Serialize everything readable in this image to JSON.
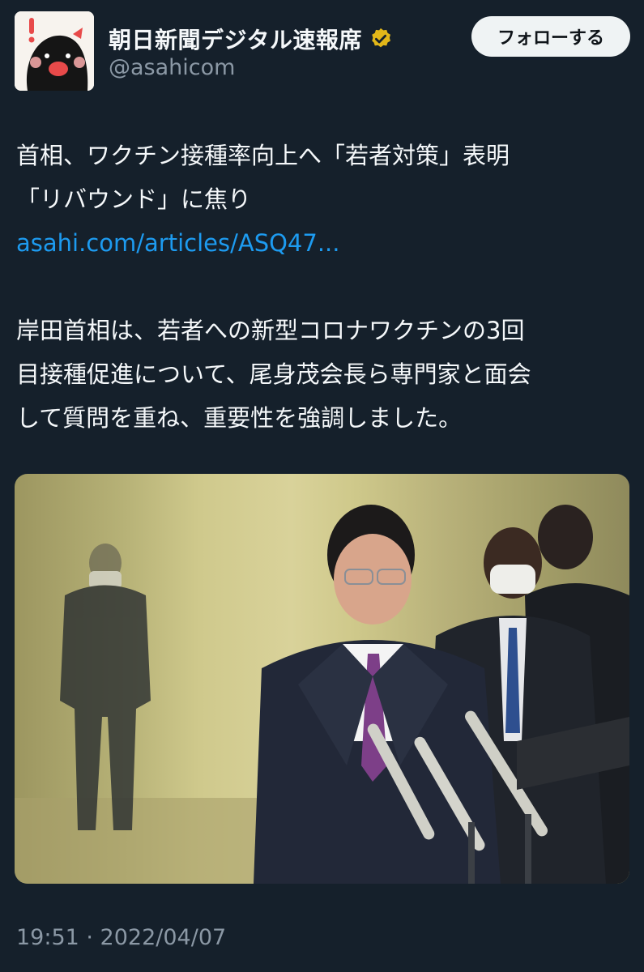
{
  "author": {
    "display_name": "朝日新聞デジタル速報席",
    "handle": "@asahicom",
    "verified_icon": "verified-badge-gold",
    "avatar_icon": "black-bird-mascot-avatar"
  },
  "follow_button": {
    "label": "フォローする"
  },
  "tweet": {
    "headline_line1": "首相、ワクチン接種率向上へ「若者対策」表明",
    "headline_line2": "「リバウンド」に焦り",
    "link_text": "asahi.com/articles/ASQ47...",
    "body_line1": "岸田首相は、若者への新型コロナワクチンの3回",
    "body_line2": "目接種促進について、尾身茂会長ら専門家と面会",
    "body_line3": "して質問を重ね、重要性を強調しました。"
  },
  "media": {
    "kind": "photo",
    "subject": "press-conference-photo"
  },
  "meta": {
    "timestamp": "19:51 · 2022/04/07"
  },
  "colors": {
    "background": "#15202b",
    "text": "#f5f8fa",
    "secondary_text": "#8b98a5",
    "link": "#1d9bf0",
    "verified_gold": "#e2b719"
  }
}
